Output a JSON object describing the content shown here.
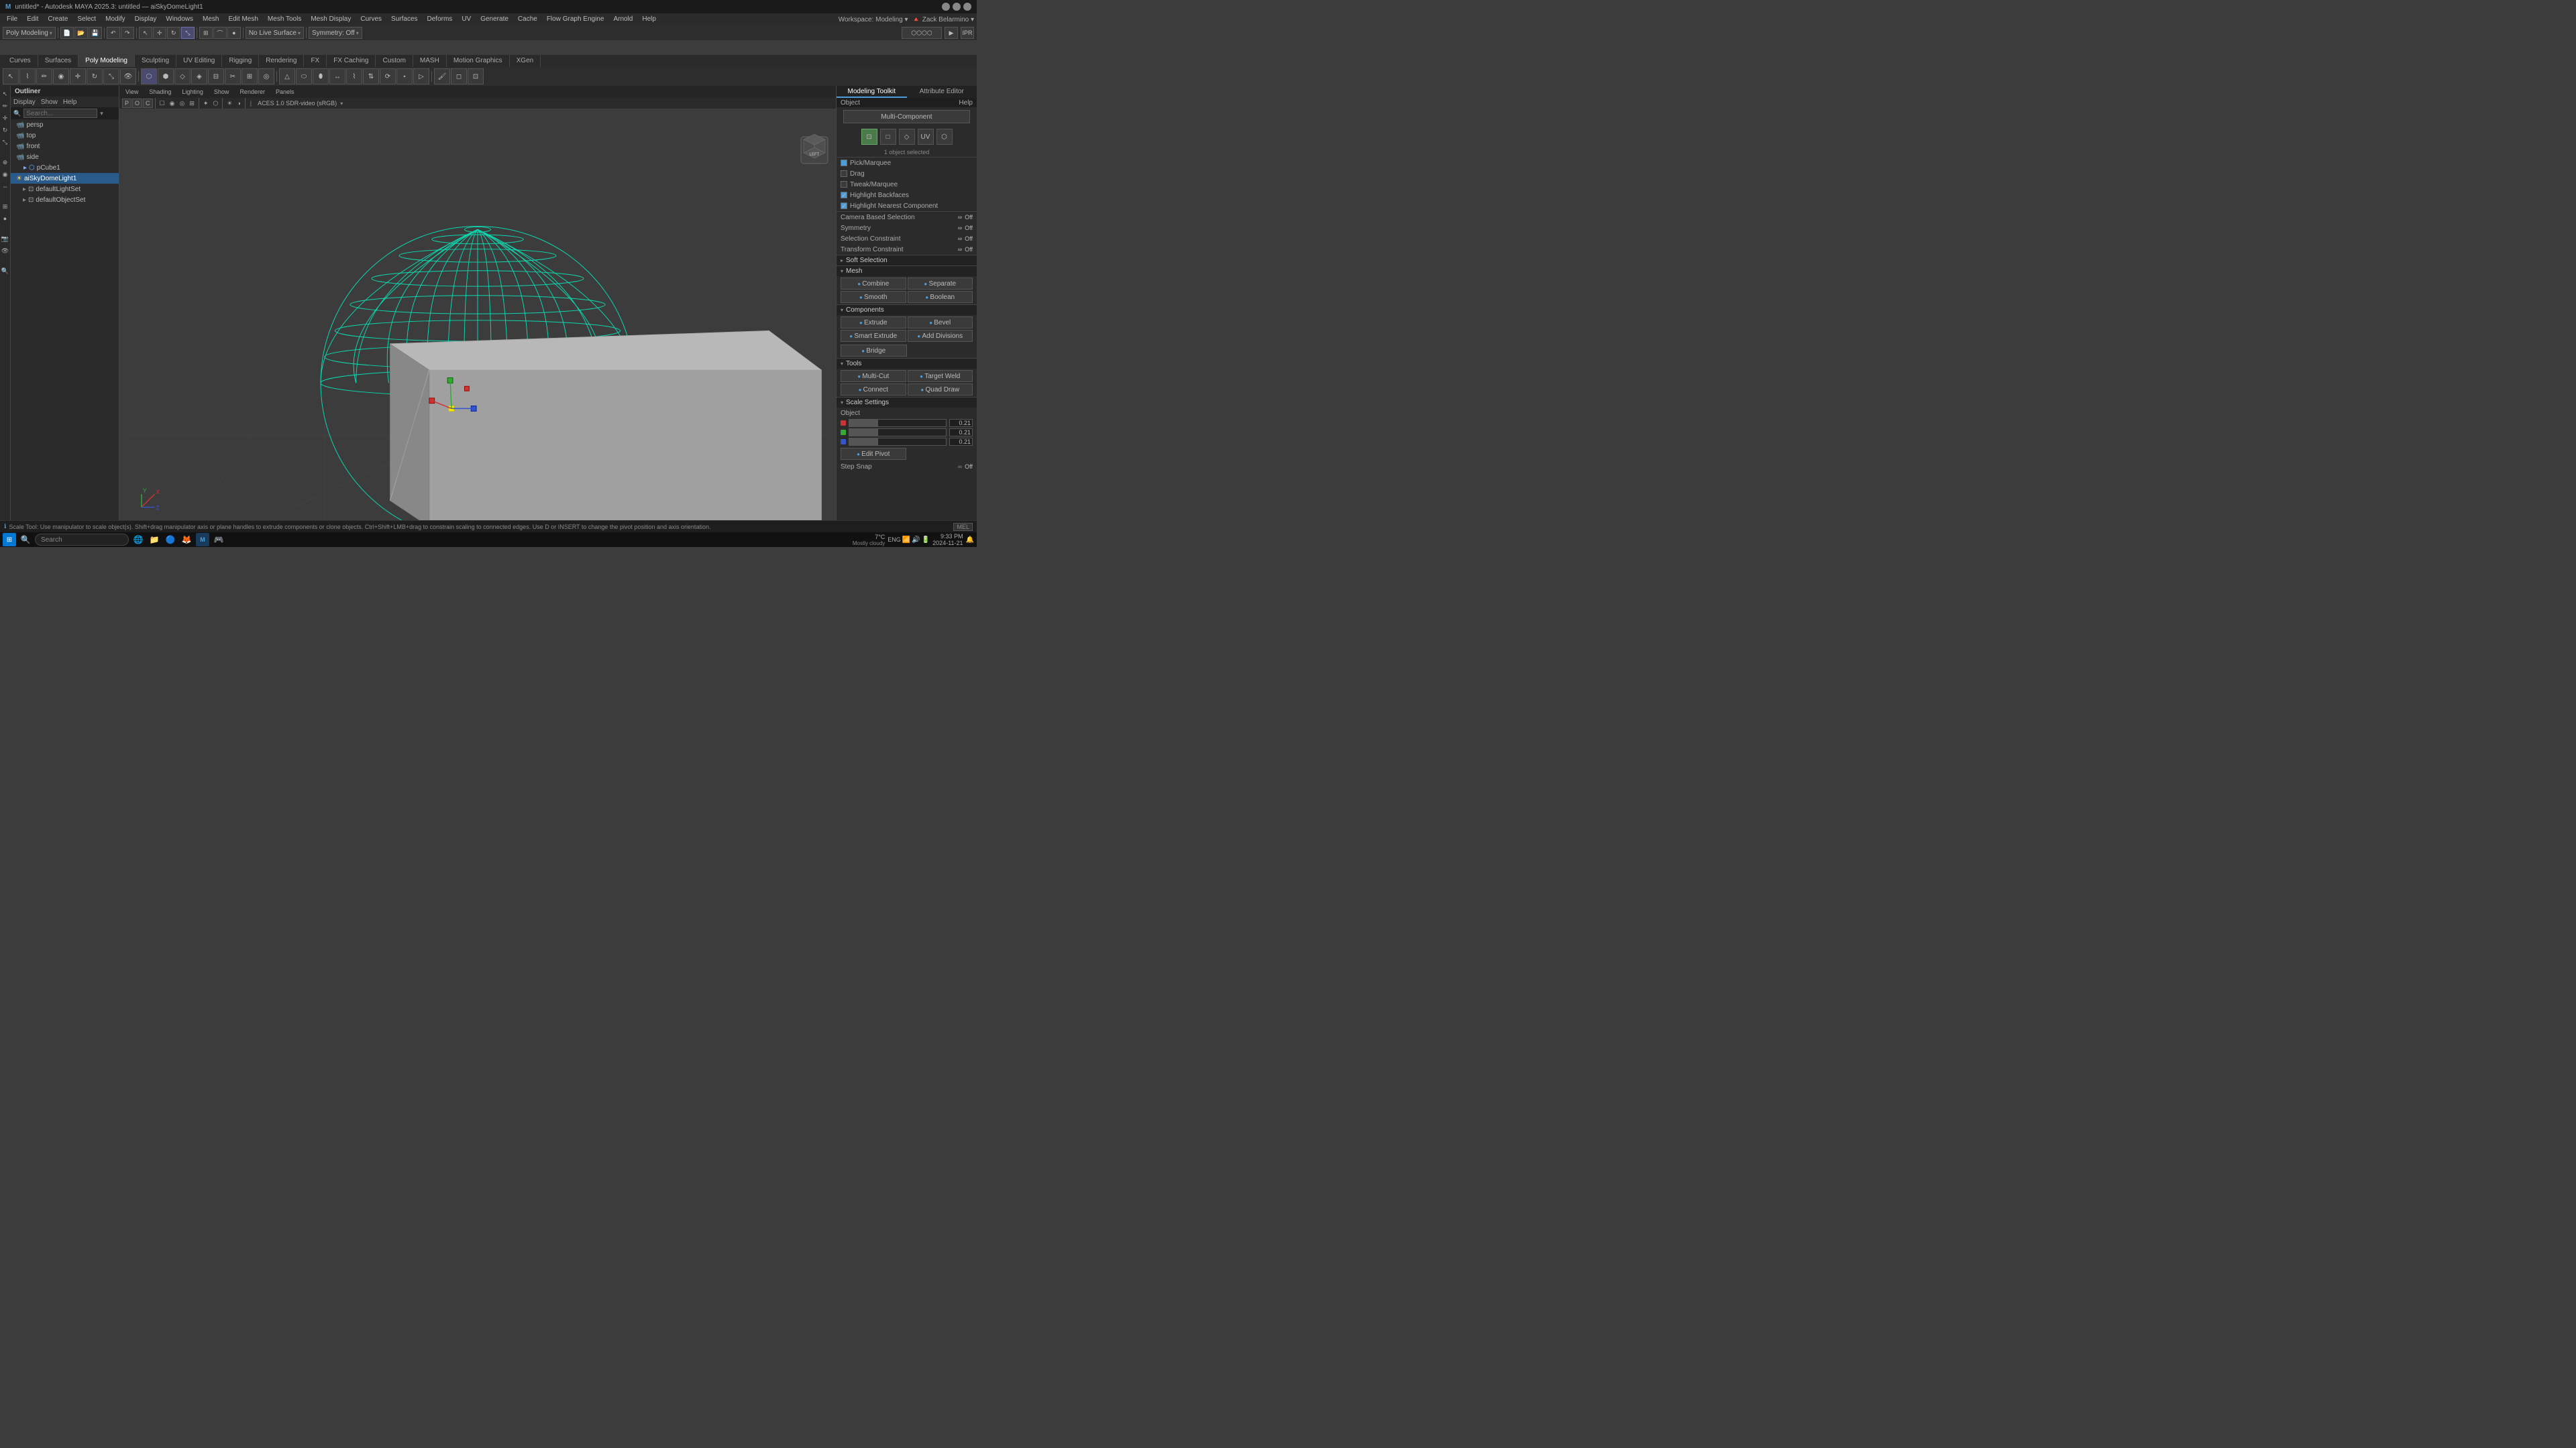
{
  "app": {
    "title": "untitled* - Autodesk MAYA 2025.3: untitled — aiSkyDomeLight1",
    "workspace": "Modeling",
    "workspace_label": "Workspace: Modeling"
  },
  "titlebar": {
    "title": "untitled* - Autodesk MAYA 2025.3: untitled — aiSkyDomeLight1",
    "minimize": "—",
    "maximize": "□",
    "close": "✕"
  },
  "menubar": {
    "items": [
      "File",
      "Edit",
      "Create",
      "Select",
      "Modify",
      "Display",
      "Windows",
      "Mesh",
      "Edit Mesh",
      "Mesh Tools",
      "Mesh Display",
      "Curves",
      "Surfaces",
      "Deforms",
      "UV",
      "Generate",
      "Cache",
      "Flow Graph Engine",
      "Arnold",
      "Help"
    ]
  },
  "mode_dropdown": {
    "label": "Poly Modeling",
    "workspace": "Workspace: Modeling"
  },
  "mode_tabs": {
    "tabs": [
      "Curves",
      "Surfaces",
      "Poly Modeling",
      "Sculpting",
      "UV Editing",
      "Rigging",
      "Rendering",
      "FX",
      "FX Caching",
      "Custom",
      "MASH",
      "Motion Graphics",
      "XGen"
    ]
  },
  "toolbar1": {
    "symmetry_label": "No Live Surface",
    "symmetry_off": "Symmetry: Off"
  },
  "outliner": {
    "title": "Outliner",
    "menu_items": [
      "Display",
      "Show",
      "Help"
    ],
    "search_placeholder": "Search...",
    "items": [
      {
        "name": "persp",
        "type": "cam",
        "indent": 0
      },
      {
        "name": "top",
        "type": "cam",
        "indent": 0
      },
      {
        "name": "front",
        "type": "cam",
        "indent": 0
      },
      {
        "name": "side",
        "type": "cam",
        "indent": 0
      },
      {
        "name": "pCube1",
        "type": "mesh",
        "indent": 0
      },
      {
        "name": "aiSkyDomeLight1",
        "type": "light",
        "indent": 0,
        "selected": true
      },
      {
        "name": "defaultLightSet",
        "type": "set",
        "indent": 1
      },
      {
        "name": "defaultObjectSet",
        "type": "set",
        "indent": 1
      }
    ]
  },
  "viewport": {
    "header_items": [
      "View",
      "Shading",
      "Lighting",
      "Show",
      "Renderer",
      "Panels"
    ],
    "camera": "persp",
    "shading": "Smooth Shaded",
    "livemode": "No Live Surface",
    "symmetry": "Symmetry: Off",
    "renderer": "ACES 1.0 SDR-video (sRGB)",
    "left_label": "LEFT"
  },
  "right_panel": {
    "title": "Modeling Toolkit",
    "tabs": [
      "Modeling Toolkit",
      "Attribute Editor"
    ],
    "sub_tabs": [
      "Object",
      "Help"
    ],
    "multi_component": "Multi-Component",
    "selection_info": "1 object selected",
    "options": {
      "pick_marquee": "Pick/Marquee",
      "drag": "Drag",
      "tweak_marquee": "Tweak/Marquee",
      "highlight_backfaces": "Highlight Backfaces",
      "highlight_nearest": "Highlight Nearest Component",
      "camera_selection": "Camera Based Selection",
      "camera_off": "Off",
      "symmetry": "Symmetry",
      "symmetry_off": "Off",
      "selection_constraint": "Selection Constraint",
      "selection_constraint_off": "Off",
      "transform_constraint": "Transform Constraint",
      "transform_constraint_off": "Off"
    },
    "soft_selection": {
      "label": "Soft Selection"
    },
    "mesh": {
      "label": "Mesh",
      "combine": "Combine",
      "separate": "Separate",
      "smooth": "Smooth",
      "boolean": "Boolean"
    },
    "components": {
      "label": "Components",
      "extrude": "Extrude",
      "bevel": "Bevel",
      "smart_extrude": "Smart Extrude",
      "add_divisions": "Add Divisions",
      "bridge": "Bridge"
    },
    "tools": {
      "label": "Tools",
      "multi_cut": "Multi-Cut",
      "target_weld": "Target Weld",
      "connect": "Connect",
      "quad_draw": "Quad Draw"
    },
    "scale_settings": {
      "label": "Scale Settings",
      "object": "Object",
      "x_val": "0.21",
      "y_val": "0.21",
      "z_val": "0.21",
      "edit_pivot": "Edit Pivot",
      "step_snap": "Step Snap",
      "step_snap_val": "Off"
    }
  },
  "statusbar": {
    "message": "Scale Tool: Use manipulator to scale object(s). Shift+drag manipulator axis or plane handles to extrude components or clone objects. Ctrl+Shift+LMB+drag to constrain scaling to connected edges. Use D or INSERT to change the pivot position and axis orientation.",
    "mel": "MEL"
  },
  "taskbar": {
    "search_label": "Search",
    "time": "9:33 PM",
    "date": "2024-11-21",
    "weather": "7°C",
    "weather_desc": "Mostly cloudy",
    "eng": "ENG",
    "temp": "7°C"
  },
  "floating_labels": {
    "selection_constraint_off": "Selection Constraint ∞  Off",
    "soft_selection": "Soft Selection"
  },
  "scene": {
    "objects": [
      {
        "type": "dome_wireframe",
        "color": "#00ffcc"
      },
      {
        "type": "cube_box",
        "color": "#aaaaaa"
      }
    ],
    "manipulator": {
      "x_color": "#cc3333",
      "y_color": "#33aa33",
      "z_color": "#3355cc",
      "center_color": "#ffff00"
    }
  }
}
